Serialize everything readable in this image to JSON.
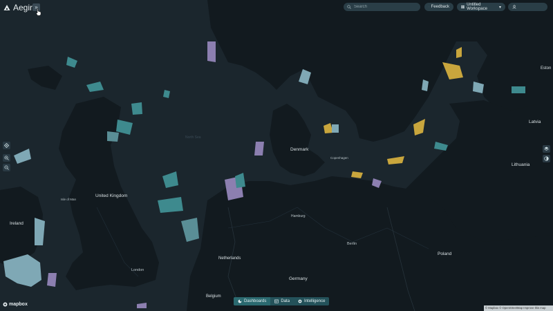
{
  "app": {
    "name": "Aegir"
  },
  "header": {
    "expand_label": "»",
    "search_placeholder": "Search",
    "feedback_label": "Feedback",
    "workspace_label": "Untitled Workspace",
    "workspace_caret": "▾"
  },
  "left_tools": [
    "locate-icon",
    "zoom-in-icon",
    "zoom-out-icon"
  ],
  "right_tools": [
    "layers-icon",
    "basemap-icon"
  ],
  "bottom_nav": [
    {
      "label": "Dashboards",
      "icon": "dashboard-icon"
    },
    {
      "label": "Data",
      "icon": "data-icon"
    },
    {
      "label": "Intelligence",
      "icon": "intelligence-icon"
    }
  ],
  "map": {
    "countries": [
      {
        "name": "Denmark"
      },
      {
        "name": "United Kingdom"
      },
      {
        "name": "Ireland"
      },
      {
        "name": "Netherlands"
      },
      {
        "name": "Germany"
      },
      {
        "name": "Poland"
      },
      {
        "name": "Belgium"
      },
      {
        "name": "Lithuania"
      },
      {
        "name": "Latvia"
      },
      {
        "name": "Eston"
      }
    ],
    "cities": [
      {
        "name": "London"
      },
      {
        "name": "Berlin"
      },
      {
        "name": "Hamburg"
      },
      {
        "name": "Copenhagen"
      },
      {
        "name": "Isle of Man"
      }
    ],
    "seas": [
      {
        "name": "North Sea"
      }
    ]
  },
  "footer": {
    "mapbox_label": "mapbox",
    "attribution": "© Mapbox © OpenStreetMap Improve this map"
  },
  "colors": {
    "zone_teal": "#3e8a8e",
    "zone_light": "#7fa8b5",
    "zone_yellow": "#c9a63d",
    "zone_purple": "#8c7fb0",
    "accent": "#2b6a70"
  }
}
